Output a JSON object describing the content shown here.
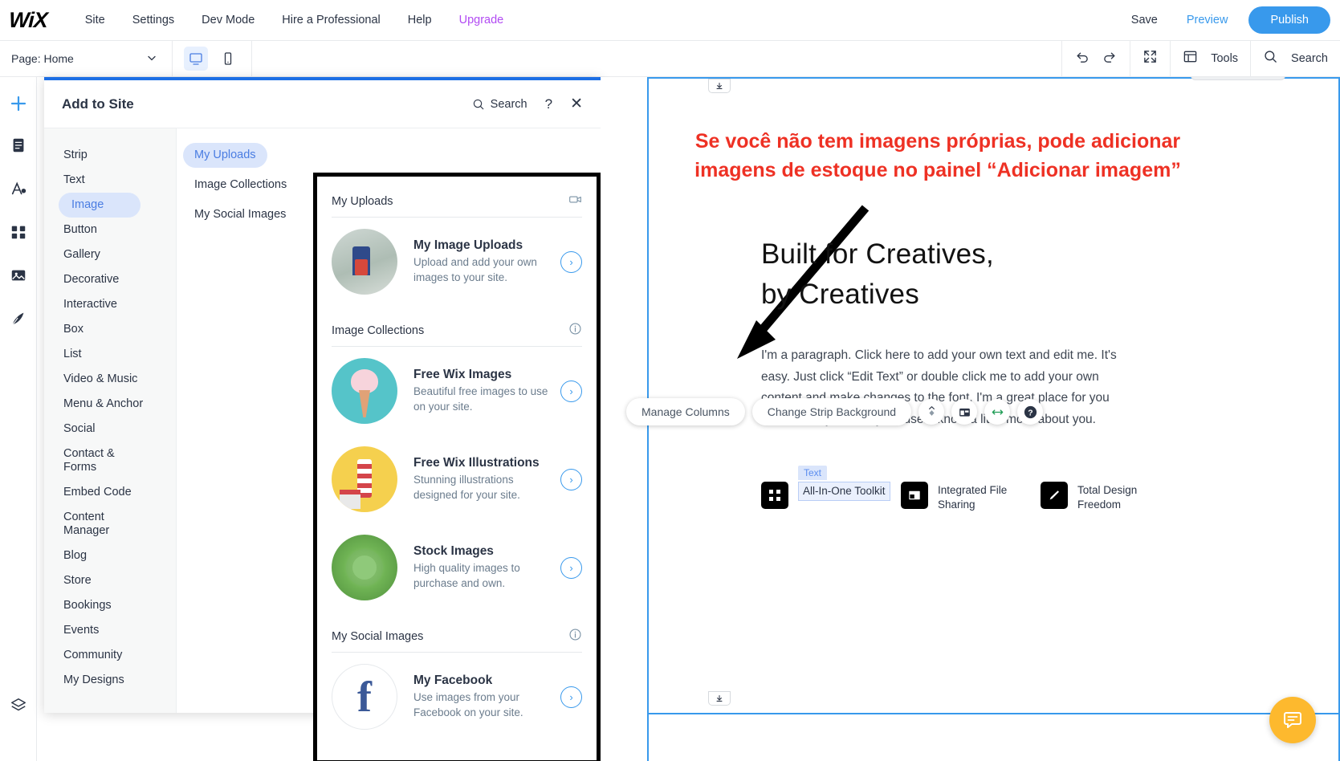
{
  "topbar": {
    "logo": "WiX",
    "menu": [
      "Site",
      "Settings",
      "Dev Mode",
      "Hire a Professional",
      "Help"
    ],
    "upgrade": "Upgrade",
    "save": "Save",
    "preview": "Preview",
    "publish": "Publish"
  },
  "toolbar": {
    "page_label": "Page: Home",
    "desktop_icon": "desktop-icon",
    "mobile_icon": "mobile-icon",
    "undo_icon": "undo-icon",
    "redo_icon": "redo-icon",
    "zoomout_icon": "zoom-out-icon",
    "tools_label": "Tools",
    "search_label": "Search"
  },
  "rail": {
    "add_icon": "plus-icon",
    "items": [
      "pages-icon",
      "theme-icon",
      "apps-icon",
      "media-icon",
      "blog-icon",
      "layers-icon"
    ]
  },
  "panel": {
    "title": "Add to Site",
    "search_label": "Search",
    "help_label": "?",
    "close_label": "✕",
    "categories": [
      "Strip",
      "Text",
      "Image",
      "Button",
      "Gallery",
      "Decorative",
      "Interactive",
      "Box",
      "List",
      "Video & Music",
      "Menu & Anchor",
      "Social",
      "Contact & Forms",
      "Embed Code",
      "Content Manager",
      "Blog",
      "Store",
      "Bookings",
      "Events",
      "Community",
      "My Designs"
    ],
    "active_category": "Image",
    "subcategories": [
      "My Uploads",
      "Image Collections",
      "My Social Images"
    ],
    "active_subcategory": "My Uploads",
    "sections": [
      {
        "title": "My Uploads",
        "icon": "video-camera-icon",
        "items": [
          {
            "title": "My Image Uploads",
            "desc": "Upload and add your own images to your site.",
            "thumb": "photo-stack-thumb",
            "arrow": "›"
          }
        ]
      },
      {
        "title": "Image Collections",
        "icon": "info-icon",
        "items": [
          {
            "title": "Free Wix Images",
            "desc": "Beautiful free images to use on your site.",
            "thumb": "ice-cream-thumb",
            "arrow": "›"
          },
          {
            "title": "Free Wix Illustrations",
            "desc": "Stunning illustrations designed for your site.",
            "thumb": "lighthouse-thumb",
            "arrow": "›"
          },
          {
            "title": "Stock Images",
            "desc": "High quality images to purchase and own.",
            "thumb": "succulent-thumb",
            "arrow": "›"
          }
        ]
      },
      {
        "title": "My Social Images",
        "icon": "info-icon",
        "items": [
          {
            "title": "My Facebook",
            "desc": "Use images from your Facebook on your site.",
            "thumb": "facebook-thumb",
            "arrow": "›"
          }
        ]
      }
    ]
  },
  "canvas": {
    "annotation": "Se você não tem imagens próprias, pode adicionar imagens de estoque no painel “Adicionar imagem”",
    "annotation_color": "#ee3124",
    "heading_line1": "Built for Creatives,",
    "heading_line2": "by Creatives",
    "paragraph": "I'm a paragraph. Click here to add your own text and edit me. It's easy. Just click “Edit Text” or double click me to add your own content and make changes to the font. I'm a great place for you to tell a story and let your users know a little more about you.",
    "floating_toolbar": {
      "manage_columns": "Manage Columns",
      "change_strip_background": "Change Strip Background",
      "icons": [
        "animation-icon",
        "layout-icon",
        "stretch-icon",
        "help-icon"
      ]
    },
    "features": [
      {
        "label": "All-In-One Toolkit",
        "icon": "grid-icon",
        "tag": "Text",
        "selected": true
      },
      {
        "label": "Integrated File Sharing",
        "icon": "window-icon",
        "tag": "",
        "selected": false
      },
      {
        "label": "Total Design Freedom",
        "icon": "pen-icon",
        "tag": "",
        "selected": false
      }
    ],
    "chat_icon": "chat-bubble-icon"
  }
}
